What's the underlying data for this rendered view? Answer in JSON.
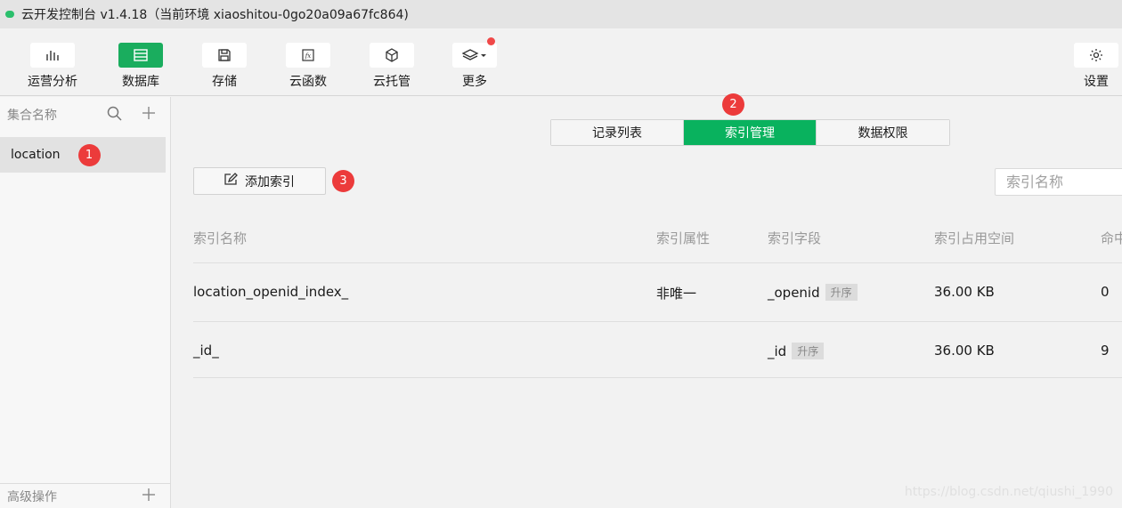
{
  "window": {
    "title": "云开发控制台 v1.4.18（当前环境 xiaoshitou-0go20a09a67fc864)"
  },
  "toolbar": {
    "items": [
      {
        "label": "运营分析",
        "icon": "bar-chart-icon"
      },
      {
        "label": "数据库",
        "icon": "database-icon"
      },
      {
        "label": "存储",
        "icon": "floppy-disk-icon"
      },
      {
        "label": "云函数",
        "icon": "function-icon"
      },
      {
        "label": "云托管",
        "icon": "cube-icon"
      },
      {
        "label": "更多",
        "icon": "layers-icon"
      }
    ],
    "settings_label": "设置"
  },
  "sidebar": {
    "header": "集合名称",
    "collections": [
      {
        "name": "location",
        "badge": "1"
      }
    ],
    "footer": "高级操作"
  },
  "tabs": {
    "items": [
      "记录列表",
      "索引管理",
      "数据权限"
    ],
    "active": "索引管理",
    "badge": "2"
  },
  "actions": {
    "add_index_label": "添加索引",
    "badge": "3",
    "search_placeholder": "索引名称"
  },
  "table": {
    "columns": [
      "索引名称",
      "索引属性",
      "索引字段",
      "索引占用空间",
      "命中"
    ],
    "rows": [
      {
        "name": "location_openid_index_",
        "attr": "非唯一",
        "field": "_openid",
        "order": "升序",
        "size": "36.00 KB",
        "hits": "0"
      },
      {
        "name": "_id_",
        "attr": "",
        "field": "_id",
        "order": "升序",
        "size": "36.00 KB",
        "hits": "9"
      }
    ]
  },
  "watermark": "https://blog.csdn.net/qiushi_1990",
  "colors": {
    "accent": "#09b25e",
    "badge": "#ec3b3b"
  }
}
